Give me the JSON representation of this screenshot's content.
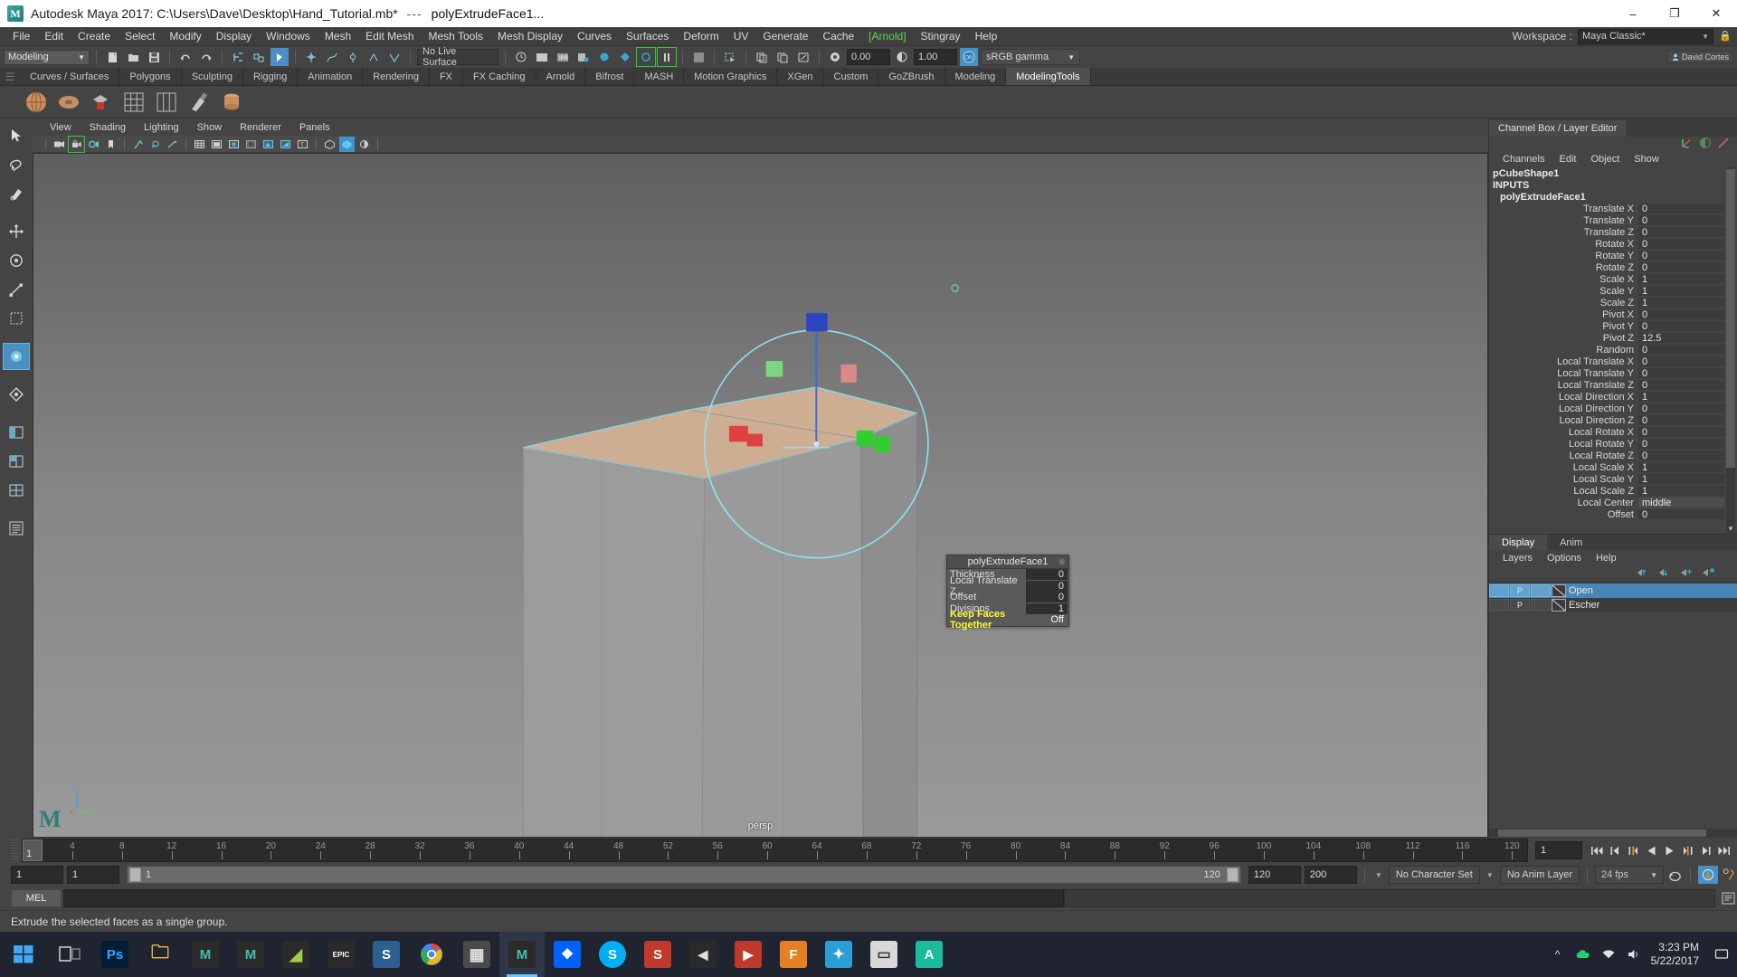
{
  "titlebar": {
    "app_title": "Autodesk Maya 2017: C:\\Users\\Dave\\Desktop\\Hand_Tutorial.mb*",
    "separator": "---",
    "context": "polyExtrudeFace1...",
    "minimize": "–",
    "maximize": "❐",
    "close": "✕"
  },
  "menubar": {
    "items": [
      {
        "label": "File"
      },
      {
        "label": "Edit"
      },
      {
        "label": "Create"
      },
      {
        "label": "Select"
      },
      {
        "label": "Modify"
      },
      {
        "label": "Display"
      },
      {
        "label": "Windows"
      },
      {
        "label": "Mesh"
      },
      {
        "label": "Edit Mesh"
      },
      {
        "label": "Mesh Tools"
      },
      {
        "label": "Mesh Display"
      },
      {
        "label": "Curves"
      },
      {
        "label": "Surfaces"
      },
      {
        "label": "Deform"
      },
      {
        "label": "UV"
      },
      {
        "label": "Generate"
      },
      {
        "label": "Cache"
      },
      {
        "label": "Arnold",
        "accent": "#5cd65c"
      },
      {
        "label": "Stingray"
      },
      {
        "label": "Help"
      }
    ],
    "workspace_label": "Workspace :",
    "workspace_value": "Maya Classic*"
  },
  "statusline": {
    "mode": "Modeling",
    "no_live_surface": "No Live Surface",
    "exposure": "0.00",
    "gamma": "1.00",
    "color_space": "sRGB gamma",
    "user_badge": "David Cortes"
  },
  "shelf": {
    "tabs": [
      "Curves / Surfaces",
      "Polygons",
      "Sculpting",
      "Rigging",
      "Animation",
      "Rendering",
      "FX",
      "FX Caching",
      "Arnold",
      "Bifrost",
      "MASH",
      "Motion Graphics",
      "XGen",
      "Custom",
      "GoZBrush",
      "Modeling",
      "ModelingTools"
    ],
    "active_tab": "ModelingTools"
  },
  "viewport": {
    "menus": [
      "View",
      "Shading",
      "Lighting",
      "Show",
      "Renderer",
      "Panels"
    ],
    "camera_label": "persp",
    "axis_labels": {
      "x": "x",
      "y": "y",
      "z": "z"
    }
  },
  "tool_hud": {
    "title": "polyExtrudeFace1",
    "rows": [
      {
        "label": "Thickness",
        "value": "0",
        "highlight": false
      },
      {
        "label": "Local Translate Z",
        "value": "0",
        "highlight": false
      },
      {
        "label": "Offset",
        "value": "0",
        "highlight": false
      },
      {
        "label": "Divisions",
        "value": "1",
        "highlight": false
      },
      {
        "label": "Keep Faces Together",
        "value": "Off",
        "highlight": true
      }
    ]
  },
  "channel_box": {
    "panel_title": "Channel Box / Layer Editor",
    "menus": [
      "Channels",
      "Edit",
      "Object",
      "Show"
    ],
    "object_name": "pCubeShape1",
    "inputs_header": "INPUTS",
    "input_node": "polyExtrudeFace1",
    "attributes": [
      {
        "name": "Translate X",
        "value": "0"
      },
      {
        "name": "Translate Y",
        "value": "0"
      },
      {
        "name": "Translate Z",
        "value": "0"
      },
      {
        "name": "Rotate X",
        "value": "0"
      },
      {
        "name": "Rotate Y",
        "value": "0"
      },
      {
        "name": "Rotate Z",
        "value": "0"
      },
      {
        "name": "Scale X",
        "value": "1"
      },
      {
        "name": "Scale Y",
        "value": "1"
      },
      {
        "name": "Scale Z",
        "value": "1"
      },
      {
        "name": "Pivot X",
        "value": "0"
      },
      {
        "name": "Pivot Y",
        "value": "0"
      },
      {
        "name": "Pivot Z",
        "value": "12.5"
      },
      {
        "name": "Random",
        "value": "0"
      },
      {
        "name": "Local Translate X",
        "value": "0"
      },
      {
        "name": "Local Translate Y",
        "value": "0"
      },
      {
        "name": "Local Translate Z",
        "value": "0"
      },
      {
        "name": "Local Direction X",
        "value": "1"
      },
      {
        "name": "Local Direction Y",
        "value": "0"
      },
      {
        "name": "Local Direction Z",
        "value": "0"
      },
      {
        "name": "Local Rotate X",
        "value": "0"
      },
      {
        "name": "Local Rotate Y",
        "value": "0"
      },
      {
        "name": "Local Rotate Z",
        "value": "0"
      },
      {
        "name": "Local Scale X",
        "value": "1"
      },
      {
        "name": "Local Scale Y",
        "value": "1"
      },
      {
        "name": "Local Scale Z",
        "value": "1"
      },
      {
        "name": "Local Center",
        "value": "middle",
        "is_string": true
      },
      {
        "name": "Offset",
        "value": "0"
      }
    ]
  },
  "layer_editor": {
    "tabs": [
      "Display",
      "Anim"
    ],
    "active_tab": "Display",
    "menus": [
      "Layers",
      "Options",
      "Help"
    ],
    "layers": [
      {
        "name": "Open",
        "p": "P",
        "selected": true
      },
      {
        "name": "Escher",
        "p": "P",
        "selected": false
      }
    ]
  },
  "timeline": {
    "current_frame": "1",
    "frame_field": "1",
    "ticks": [
      4,
      8,
      12,
      16,
      20,
      24,
      28,
      32,
      36,
      40,
      44,
      48,
      52,
      56,
      60,
      64,
      68,
      72,
      76,
      80,
      84,
      88,
      92,
      96,
      100,
      104,
      108,
      112,
      116,
      120
    ],
    "range_start": "1",
    "range_start2": "1",
    "slider_start": "1",
    "slider_end": "120",
    "range_end": "120",
    "playback_end": "200",
    "character_set": "No Character Set",
    "anim_layer": "No Anim Layer",
    "fps": "24 fps"
  },
  "command_line": {
    "language": "MEL"
  },
  "help_line": {
    "text": "Extrude the selected faces as a single group."
  },
  "taskbar": {
    "apps": [
      {
        "name": "photoshop",
        "label": "Ps",
        "bg": "#001e36",
        "fg": "#31a8ff"
      },
      {
        "name": "file-explorer",
        "label": "🗀",
        "bg": "transparent",
        "fg": "#ffc64d"
      },
      {
        "name": "maya-1",
        "label": "M",
        "bg": "#2b2b2b",
        "fg": "#3dbfae"
      },
      {
        "name": "maya-2",
        "label": "M",
        "bg": "#2b2b2b",
        "fg": "#3dbfae"
      },
      {
        "name": "mudbox",
        "label": "◢",
        "bg": "#2b2b2b",
        "fg": "#9dcf4a"
      },
      {
        "name": "epic-games",
        "label": "EPIC",
        "bg": "#2a2a2a",
        "fg": "#ffffff"
      },
      {
        "name": "substance",
        "label": "S",
        "bg": "#2a5f8f",
        "fg": "#ffffff"
      },
      {
        "name": "chrome",
        "label": "◉",
        "bg": "transparent",
        "fg": "#4285f4"
      },
      {
        "name": "calculator",
        "label": "▦",
        "bg": "#4a4a4a",
        "fg": "#e0e0e0"
      },
      {
        "name": "maya-active",
        "label": "M",
        "bg": "#2b2b2b",
        "fg": "#3dbfae"
      },
      {
        "name": "dropbox",
        "label": "❖",
        "bg": "#0061fe",
        "fg": "#ffffff"
      },
      {
        "name": "skype",
        "label": "S",
        "bg": "#00aff0",
        "fg": "#ffffff"
      },
      {
        "name": "substance-painter",
        "label": "S",
        "bg": "#c0392b",
        "fg": "#ffffff"
      },
      {
        "name": "speaker-app",
        "label": "◀",
        "bg": "#2a2a2a",
        "fg": "#e0e0e0"
      },
      {
        "name": "adobe-animate",
        "label": "▶",
        "bg": "#c0392b",
        "fg": "#ffffff"
      },
      {
        "name": "fusion",
        "label": "F",
        "bg": "#e67e22",
        "fg": "#ffffff"
      },
      {
        "name": "mixamo",
        "label": "✦",
        "bg": "#2a9fd6",
        "fg": "#ffffff"
      },
      {
        "name": "blank-app",
        "label": "▭",
        "bg": "#d8d8d8",
        "fg": "#333333"
      },
      {
        "name": "autodesk-app",
        "label": "A",
        "bg": "#1abc9c",
        "fg": "#ffffff"
      }
    ],
    "time": "3:23 PM",
    "date": "5/22/2017"
  }
}
